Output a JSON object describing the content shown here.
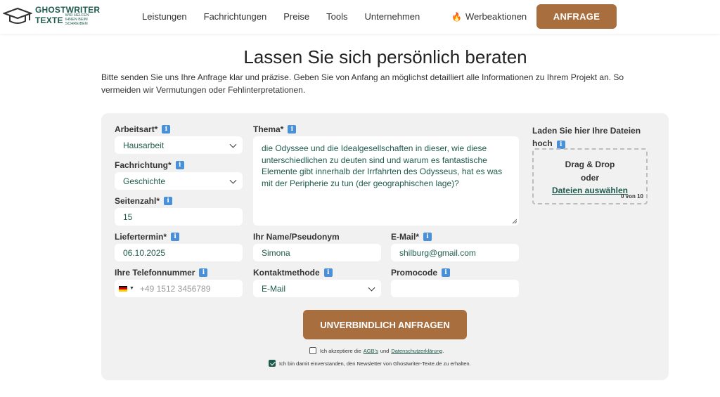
{
  "header": {
    "logo_line1": "GHOSTWRITER",
    "logo_line2": "TEXTE",
    "logo_tagline": "WIR HELFEN IHNEN BEIM SCHREIBEN",
    "nav": [
      "Leistungen",
      "Fachrichtungen",
      "Preise",
      "Tools",
      "Unternehmen"
    ],
    "promo_label": "Werbeaktionen",
    "cta_label": "ANFRAGE"
  },
  "page": {
    "title": "Lassen Sie sich persönlich beraten",
    "intro": "Bitte senden Sie uns Ihre Anfrage klar und präzise. Geben Sie von Anfang an möglichst detailliert alle Informationen zu Ihrem Projekt an. So vermeiden wir Vermutungen oder Fehlinterpretationen."
  },
  "form": {
    "arbeitsart": {
      "label": "Arbeitsart*",
      "value": "Hausarbeit"
    },
    "fachrichtung": {
      "label": "Fachrichtung*",
      "value": "Geschichte"
    },
    "seitenzahl": {
      "label": "Seitenzahl*",
      "value": "15"
    },
    "liefertermin": {
      "label": "Liefertermin*",
      "value": "06.10.2025"
    },
    "telefon": {
      "label": "Ihre Telefonnummer",
      "placeholder": "+49 1512 3456789"
    },
    "thema": {
      "label": "Thema*",
      "value": "die Odyssee und die Idealgesellschaften in dieser, wie diese unterschiedlichen zu deuten sind und warum es fantastische Elemente gibt innerhalb der Irrfahrten des Odysseus, hat es was mit der Peripherie zu tun (der geographischen lage)?"
    },
    "name": {
      "label": "Ihr Name/Pseudonym",
      "value": "Simona"
    },
    "kontaktmethode": {
      "label": "Kontaktmethode",
      "value": "E-Mail"
    },
    "email": {
      "label": "E-Mail*",
      "value": "shilburg@gmail.com"
    },
    "promocode": {
      "label": "Promocode",
      "value": ""
    },
    "upload": {
      "label": "Laden Sie hier Ihre Dateien hoch",
      "drag": "Drag & Drop",
      "or": "oder",
      "link": "Dateien auswählen",
      "count": "0 von 10"
    },
    "submit_label": "UNVERBINDLICH ANFRAGEN",
    "consent1": {
      "pre": "Ich akzeptiere die",
      "link1": "AGB's",
      "mid": "und",
      "link2": "Datenschutzerklärung",
      "post": ".",
      "checked": false
    },
    "consent2": {
      "text": "Ich bin damit einverstanden, den Newsletter von Ghostwriter-Texte.de zu erhalten.",
      "checked": true
    }
  },
  "colors": {
    "brand_green": "#1f5b4c",
    "accent_brown": "#a86e3e",
    "info_blue": "#4a90d9"
  }
}
